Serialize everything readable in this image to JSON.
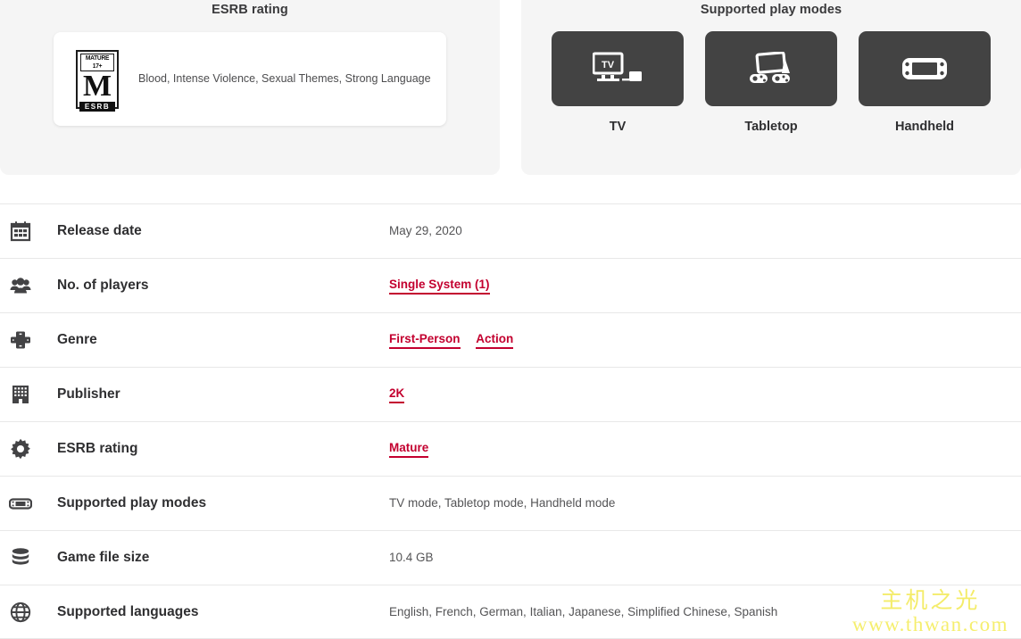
{
  "esrb_panel": {
    "title": "ESRB rating",
    "logo": {
      "top_text": "MATURE 17+",
      "letter": "M",
      "bottom_text": "ESRB"
    },
    "descriptors": "Blood, Intense Violence, Sexual Themes, Strong Language"
  },
  "play_modes_panel": {
    "title": "Supported play modes",
    "modes": [
      {
        "label": "TV",
        "icon": "tv-mode-icon"
      },
      {
        "label": "Tabletop",
        "icon": "tabletop-mode-icon"
      },
      {
        "label": "Handheld",
        "icon": "handheld-mode-icon"
      }
    ]
  },
  "details": [
    {
      "icon": "calendar-icon",
      "label": "Release date",
      "value": "May 29, 2020",
      "links": []
    },
    {
      "icon": "players-icon",
      "label": "No. of players",
      "value": "",
      "links": [
        "Single System (1)"
      ]
    },
    {
      "icon": "dpad-icon",
      "label": "Genre",
      "value": "",
      "links": [
        "First-Person",
        "Action"
      ]
    },
    {
      "icon": "building-icon",
      "label": "Publisher",
      "value": "",
      "links": [
        "2K"
      ]
    },
    {
      "icon": "gear-icon",
      "label": "ESRB rating",
      "value": "",
      "links": [
        "Mature"
      ]
    },
    {
      "icon": "handheld-console-icon",
      "label": "Supported play modes",
      "value": "TV mode, Tabletop mode, Handheld mode",
      "links": []
    },
    {
      "icon": "database-icon",
      "label": "Game file size",
      "value": "10.4 GB",
      "links": []
    },
    {
      "icon": "globe-icon",
      "label": "Supported languages",
      "value": "English, French, German, Italian, Japanese, Simplified Chinese, Spanish",
      "links": []
    }
  ],
  "watermark": {
    "chinese": "主机之光",
    "url": "www.thwan.com"
  },
  "colors": {
    "link": "#c3002f",
    "panel_bg": "#f5f5f5",
    "tile_bg": "#434343",
    "watermark": "#f2e84a"
  }
}
